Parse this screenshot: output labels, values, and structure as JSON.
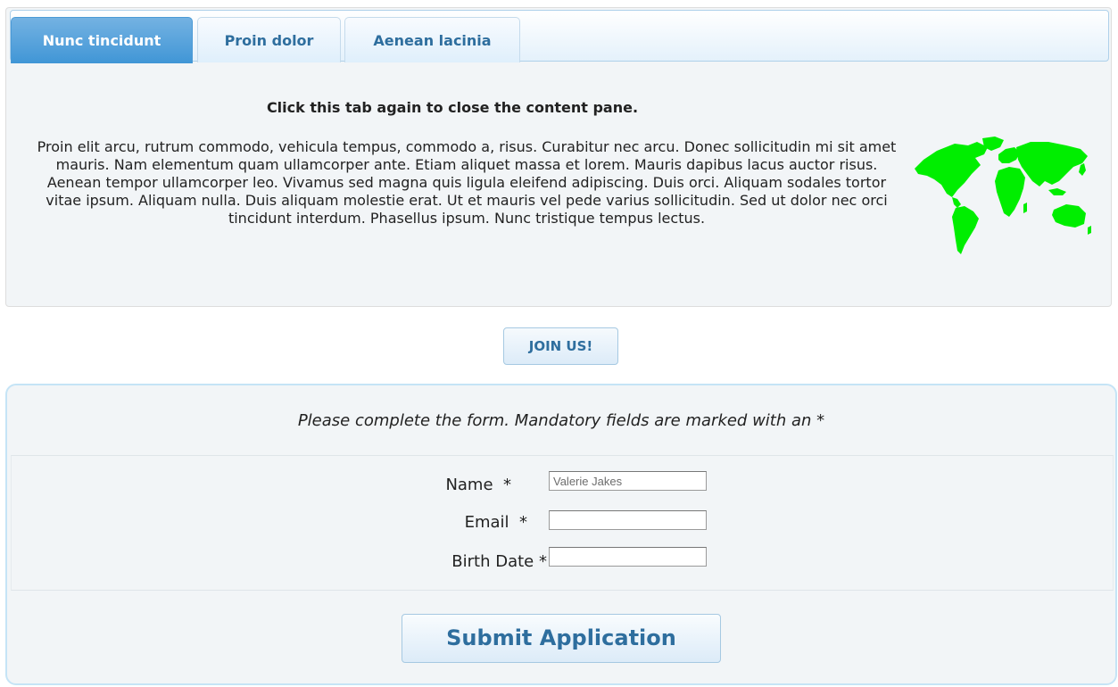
{
  "tabs": {
    "items": [
      {
        "label": "Nunc tincidunt",
        "active": true
      },
      {
        "label": "Proin dolor",
        "active": false
      },
      {
        "label": "Aenean lacinia",
        "active": false
      }
    ],
    "pane": {
      "title": "Click this tab again to close the content pane.",
      "text": "Proin elit arcu, rutrum commodo, vehicula tempus, commodo a, risus. Curabitur nec arcu. Donec sollicitudin mi sit amet mauris. Nam elementum quam ullamcorper ante. Etiam aliquet massa et lorem. Mauris dapibus lacus auctor risus. Aenean tempor ullamcorper leo. Vivamus sed magna quis ligula eleifend adipiscing. Duis orci. Aliquam sodales tortor vitae ipsum. Aliquam nulla. Duis aliquam molestie erat. Ut et mauris vel pede varius sollicitudin. Sed ut dolor nec orci tincidunt interdum. Phasellus ipsum. Nunc tristique tempus lectus.",
      "image_icon": "world-map-icon",
      "image_color": "#00ee00"
    }
  },
  "join_button": {
    "label": "JOIN US!"
  },
  "form": {
    "intro": "Please complete the form. Mandatory fields are marked with an *",
    "fields": {
      "name": {
        "label": "Name",
        "required_mark": "*",
        "value": "Valerie Jakes"
      },
      "email": {
        "label": "Email",
        "required_mark": "*",
        "value": ""
      },
      "birth_date": {
        "label": "Birth Date",
        "required_mark": "*",
        "value": ""
      }
    },
    "submit_label": "Submit Application"
  },
  "colors": {
    "accent": "#2e6e9e",
    "active_tab": "#4096d6",
    "panel_bg": "#f2f5f7"
  }
}
